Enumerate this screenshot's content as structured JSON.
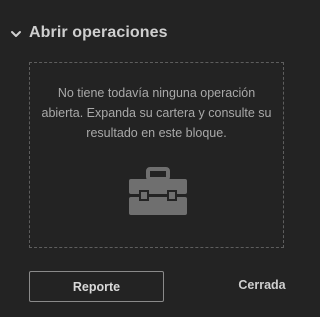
{
  "section": {
    "title": "Abrir operaciones",
    "collapse_icon": "chevron-down-icon"
  },
  "empty_state": {
    "message": "No tiene todavía ninguna operación abierta. Expanda su cartera y consulte su resultado en este bloque.",
    "icon": "briefcase-icon"
  },
  "footer": {
    "report_label": "Reporte",
    "closed_label": "Cerrada"
  },
  "colors": {
    "background": "#232323",
    "text_primary": "#cfcfcf",
    "text_secondary": "#a9a9a9",
    "border": "#5e5e5e",
    "icon": "#6f6f6f"
  }
}
